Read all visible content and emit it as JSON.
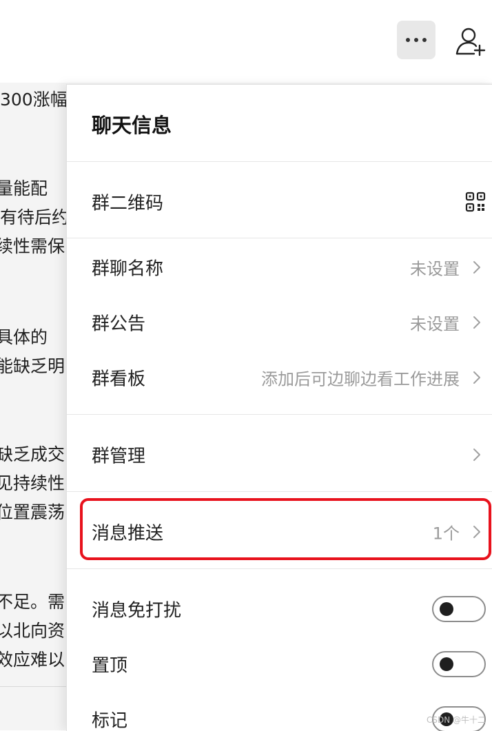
{
  "chat_background": {
    "lines": [
      "300涨幅",
      "量能配",
      "有待后约",
      "续性需保",
      "具体的",
      "能缺乏明",
      "缺乏成交",
      "见持续性",
      "位置震荡",
      "不足。需",
      "以北向资",
      "效应难以"
    ]
  },
  "panel": {
    "title": "聊天信息",
    "qr_label": "群二维码",
    "rows": [
      {
        "label": "群聊名称",
        "value": "未设置"
      },
      {
        "label": "群公告",
        "value": "未设置"
      },
      {
        "label": "群看板",
        "value": "添加后可边聊边看工作进展"
      },
      {
        "label": "群管理",
        "value": ""
      },
      {
        "label": "消息推送",
        "value": "1个"
      }
    ],
    "toggles": [
      {
        "label": "消息免打扰",
        "on": false
      },
      {
        "label": "置顶",
        "on": false
      },
      {
        "label": "标记",
        "on": false
      }
    ]
  },
  "watermark": "CSDN @牛十二",
  "colors": {
    "highlight": "#e8121d",
    "muted_text": "#9a9a9a",
    "more_button_bg": "#e8e8e8"
  },
  "icons": {
    "more": "more-horizontal-icon",
    "add_member": "add-member-icon",
    "qr": "qr-code-icon",
    "chevron": "chevron-right-icon"
  }
}
